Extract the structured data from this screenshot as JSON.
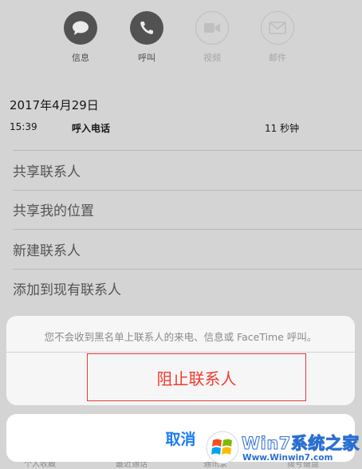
{
  "actions": [
    {
      "label": "信息",
      "icon": "message-icon",
      "enabled": true
    },
    {
      "label": "呼叫",
      "icon": "phone-icon",
      "enabled": true
    },
    {
      "label": "视频",
      "icon": "video-icon",
      "enabled": false
    },
    {
      "label": "邮件",
      "icon": "mail-icon",
      "enabled": false
    }
  ],
  "history": {
    "date": "2017年4月29日",
    "time": "15:39",
    "type": "呼入电话",
    "duration": "11 秒钟"
  },
  "menu": [
    {
      "label": "共享联系人"
    },
    {
      "label": "共享我的位置"
    },
    {
      "label": "新建联系人"
    },
    {
      "label": "添加到现有联系人"
    }
  ],
  "footer_tabs": [
    "个人收藏",
    "最近通话",
    "通讯录",
    "拨号键盘"
  ],
  "action_sheet": {
    "message": "您不会收到黑名单上联系人的来电、信息或 FaceTime 呼叫。",
    "block_label": "阻止联系人",
    "cancel_label": "取消"
  },
  "watermark": {
    "title": "Win7系统之家",
    "url": "Www.Winwin7.com"
  },
  "colors": {
    "destructive": "#f13a2f",
    "accent": "#1a7cf5",
    "highlight_box": "#e83b3b"
  }
}
